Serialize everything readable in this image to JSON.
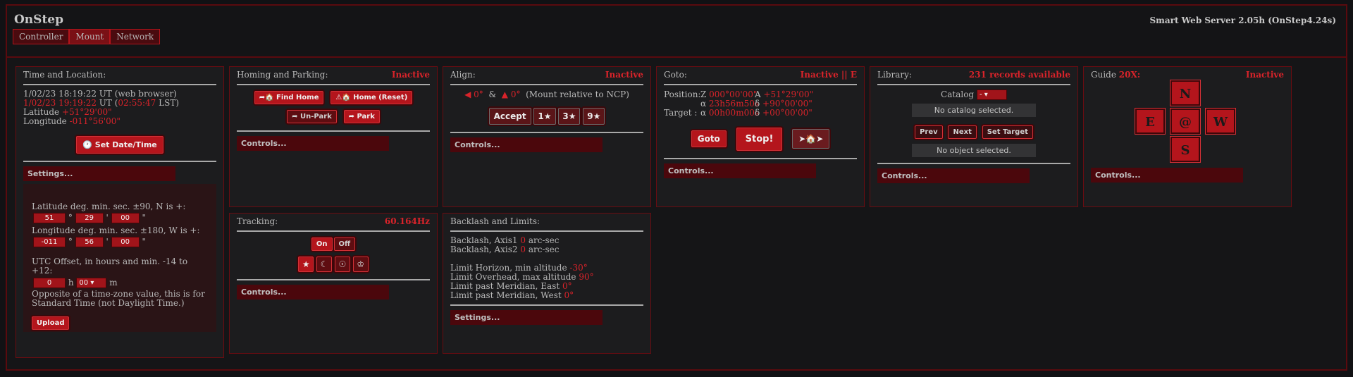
{
  "app": {
    "title": "OnStep",
    "version": "Smart Web Server 2.05h (OnStep4.24s)"
  },
  "nav": {
    "tabs": [
      {
        "label": "Controller"
      },
      {
        "label": "Mount"
      },
      {
        "label": "Network"
      }
    ]
  },
  "time_location": {
    "title": "Time and Location:",
    "browser_time": "1/02/23 18:19:22 UT (web browser)",
    "ut": "1/02/23 19:19:22",
    "ut_suffix": " UT (",
    "lst": "02:55:47",
    "lst_suffix": " LST)",
    "latitude_label": "Latitude ",
    "latitude": "+51°29'00\"",
    "longitude_label": "Longitude ",
    "longitude": "-011°56'00\"",
    "set_button": "Set Date/Time",
    "settings_bar": "Settings...",
    "lat_help": "Latitude deg. min. sec. ±90, N is +:",
    "lat_deg": "51",
    "lat_min": "29",
    "lat_sec": "00",
    "lon_help": "Longitude deg. min. sec. ±180, W is +:",
    "lon_deg": "-011",
    "lon_min": "56",
    "lon_sec": "00",
    "utc_help": "UTC Offset, in hours and min. -14 to +12:",
    "utc_h": "0",
    "utc_h_unit": "h",
    "utc_m": "00",
    "utc_m_unit": "m",
    "utc_note_1": "Opposite of a time-zone value, this is for",
    "utc_note_2": "Standard Time (not Daylight Time.)",
    "upload_button": "Upload",
    "deg_sym": "°",
    "min_sym": "'",
    "sec_sym": "\""
  },
  "homing": {
    "title": "Homing and Parking:",
    "status": "Inactive",
    "find_home": "Find Home",
    "home_reset": "Home (Reset)",
    "unpark": "Un-Park",
    "park": "Park",
    "controls": "Controls..."
  },
  "tracking": {
    "title": "Tracking:",
    "rate": "60.164Hz",
    "on": "On",
    "off": "Off",
    "controls": "Controls..."
  },
  "align": {
    "title": "Align:",
    "status": "Inactive",
    "axis1": "0°",
    "amp": "&",
    "axis2": "0°",
    "note": "(Mount relative to NCP)",
    "accept": "Accept",
    "one_star": "1★",
    "three_star": "3★",
    "nine_star": "9★",
    "controls": "Controls..."
  },
  "backlash": {
    "title": "Backlash and Limits:",
    "ax1_label": "Backlash, Axis1 ",
    "ax1": "0",
    "ax1_unit": " arc-sec",
    "ax2_label": "Backlash, Axis2 ",
    "ax2": "0",
    "ax2_unit": " arc-sec",
    "horizon_label": "Limit Horizon, min altitude ",
    "horizon": "-30°",
    "overhead_label": "Limit Overhead, max altitude ",
    "overhead": "90°",
    "east_label": "Limit past Meridian, East ",
    "east": "0°",
    "west_label": "Limit past Meridian, West ",
    "west": "0°",
    "settings": "Settings..."
  },
  "goto": {
    "title": "Goto:",
    "status": "Inactive || E",
    "position_label": "Position:",
    "target_label": "Target  :",
    "pos_z_label": "Z ",
    "pos_z": "000°00'00\"",
    "pos_a_label": "A ",
    "pos_a": "+51°29'00\"",
    "pos_ra_label": "α ",
    "pos_ra": "23h56m50s",
    "pos_dec_label": "δ ",
    "pos_dec": "+90°00'00\"",
    "tgt_ra_label": "α ",
    "tgt_ra": "00h00m00s",
    "tgt_dec_label": "δ ",
    "tgt_dec": "+00°00'00\"",
    "goto_button": "Goto",
    "stop_button": "Stop!",
    "controls": "Controls..."
  },
  "library": {
    "title": "Library:",
    "status": "231 records available",
    "catalog_label": "Catalog",
    "catalog_value": "-",
    "no_catalog": "No catalog selected.",
    "prev": "Prev",
    "next": "Next",
    "set_target": "Set Target",
    "no_object": "No object selected.",
    "controls": "Controls..."
  },
  "guide": {
    "title": "Guide ",
    "rate": "20X:",
    "status": "Inactive",
    "n": "N",
    "e": "E",
    "sync": "@",
    "w": "W",
    "s": "S",
    "controls": "Controls..."
  },
  "colors": {
    "accent": "#d8232a",
    "button": "#b4151c",
    "border": "#6a0c11",
    "background": "#111114"
  }
}
